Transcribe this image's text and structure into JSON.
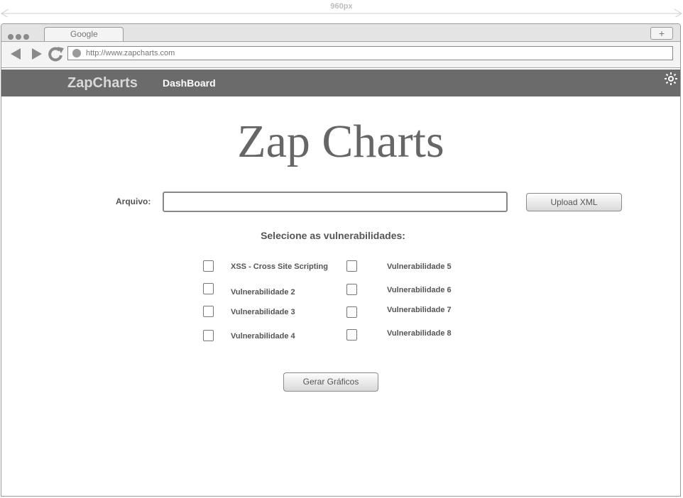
{
  "ruler": {
    "label": "960px"
  },
  "browser": {
    "tab_title": "Google",
    "new_tab_label": "+",
    "url": "http://www.zapcharts.com"
  },
  "nav": {
    "brand": "ZapCharts",
    "dashboard_link": "DashBoard",
    "settings_icon": "sun-icon"
  },
  "main": {
    "title": "Zap Charts",
    "file_label": "Arquivo:",
    "file_value": "",
    "upload_button": "Upload XML",
    "section_title": "Selecione as vulnerabilidades:",
    "vulnerabilities": [
      {
        "label": "XSS - Cross Site Scripting",
        "checked": false
      },
      {
        "label": "Vulnerabilidade 2",
        "checked": false
      },
      {
        "label": "Vulnerabilidade 3",
        "checked": false
      },
      {
        "label": "Vulnerabilidade 4",
        "checked": false
      },
      {
        "label": "Vulnerabilidade 5",
        "checked": false
      },
      {
        "label": "Vulnerabilidade 6",
        "checked": false
      },
      {
        "label": "Vulnerabilidade 7",
        "checked": false
      },
      {
        "label": "Vulnerabilidade 8",
        "checked": false
      }
    ],
    "generate_button": "Gerar Gráficos"
  }
}
